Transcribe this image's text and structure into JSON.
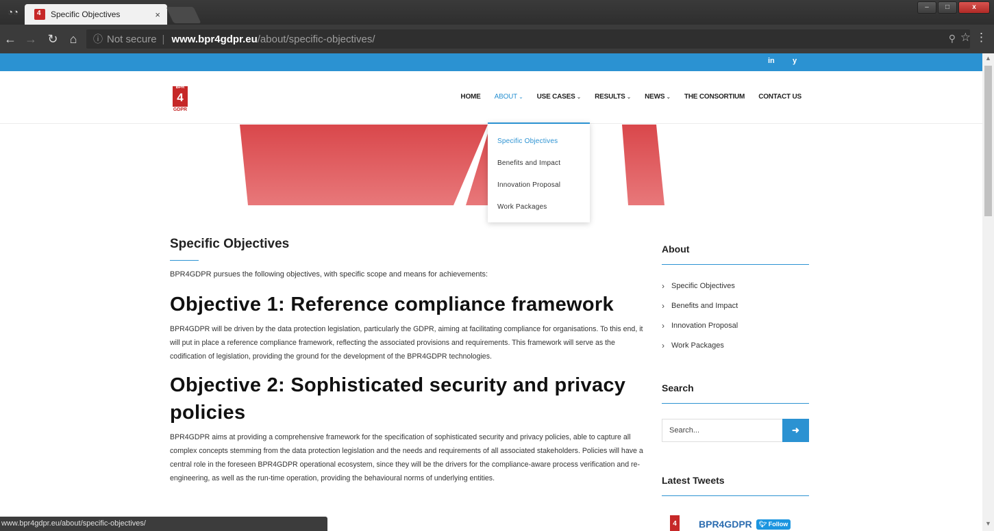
{
  "browser": {
    "tab_title": "Specific Objectives",
    "tab_close": "×",
    "not_secure": "Not secure",
    "url_host": "www.bpr4gdpr.eu",
    "url_path": "/about/specific-objectives/",
    "status_url": "www.bpr4gdpr.eu/about/specific-objectives/",
    "window_min": "–",
    "window_max": "□",
    "window_close": "x"
  },
  "topbar": {
    "social": [
      "in",
      "y"
    ]
  },
  "logo": {
    "number": "4",
    "text": "GDPR"
  },
  "nav": {
    "items": [
      {
        "label": "HOME",
        "caret": ""
      },
      {
        "label": "ABOUT",
        "caret": "⌄"
      },
      {
        "label": "USE CASES",
        "caret": "⌄"
      },
      {
        "label": "RESULTS",
        "caret": "⌄"
      },
      {
        "label": "NEWS",
        "caret": "⌄"
      },
      {
        "label": "THE CONSORTIUM",
        "caret": ""
      },
      {
        "label": "CONTACT US",
        "caret": ""
      }
    ]
  },
  "dropdown": {
    "items": [
      "Specific Objectives",
      "Benefits and Impact",
      "Innovation Proposal",
      "Work Packages"
    ]
  },
  "content": {
    "title": "Specific Objectives",
    "intro": "BPR4GDPR pursues the following objectives, with specific scope and means for achievements:",
    "objectives": [
      {
        "heading": "Objective 1: Reference compliance framework",
        "text": "BPR4GDPR will be driven by the data protection legislation, particularly the GDPR, aiming at facilitating compliance for organisations. To this end, it will put in place a reference compliance framework, reflecting the associated provisions and requirements. This framework will serve as the codification of legislation, providing the ground for the development of the BPR4GDPR technologies."
      },
      {
        "heading": "Objective 2: Sophisticated security and privacy policies",
        "text": "BPR4GDPR aims at providing a comprehensive framework for the specification of sophisticated security and privacy policies, able to capture all complex concepts stemming from the data protection legislation and the needs and requirements of all associated stakeholders. Policies will have a central role in the foreseen BPR4GDPR operational ecosystem, since they will be the drivers for the compliance-aware process verification and re-engineering, as well as the run-time operation, providing the behavioural norms of underlying entities."
      }
    ]
  },
  "sidebar": {
    "about_heading": "About",
    "about_items": [
      "Specific Objectives",
      "Benefits and Impact",
      "Innovation Proposal",
      "Work Packages"
    ],
    "search_heading": "Search",
    "search_placeholder": "Search...",
    "search_button": "➜",
    "tweets_heading": "Latest Tweets",
    "tweet_account": "BPR4GDPR",
    "follow_label": "Follow"
  }
}
